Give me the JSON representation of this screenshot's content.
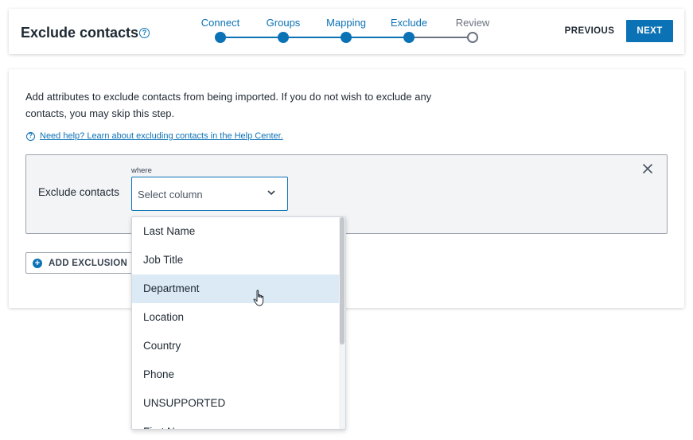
{
  "header": {
    "title": "Exclude contacts",
    "help_icon": "question-circle-icon",
    "steps": [
      {
        "label": "Connect",
        "state": "done"
      },
      {
        "label": "Groups",
        "state": "done"
      },
      {
        "label": "Mapping",
        "state": "done"
      },
      {
        "label": "Exclude",
        "state": "done"
      },
      {
        "label": "Review",
        "state": "todo"
      }
    ],
    "previous_label": "PREVIOUS",
    "next_label": "NEXT"
  },
  "main": {
    "description": "Add attributes to exclude contacts from being imported. If you do not wish to exclude any contacts, you may skip this step.",
    "help_link": "Need help? Learn about excluding contacts in the Help Center.",
    "rule": {
      "label": "Exclude contacts",
      "where_label": "where",
      "select_placeholder": "Select column"
    },
    "add_exclusion_label": "ADD EXCLUSION"
  },
  "dropdown": {
    "items": [
      "Last Name",
      "Job Title",
      "Department",
      "Location",
      "Country",
      "Phone",
      "UNSUPPORTED",
      "First Name"
    ],
    "hovered_index": 2
  },
  "colors": {
    "accent": "#0b72b5",
    "hover": "#dbeaf5",
    "todo": "#6b7280"
  }
}
